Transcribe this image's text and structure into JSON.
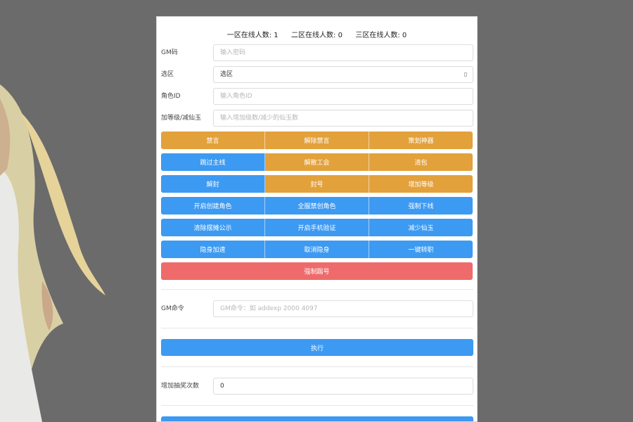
{
  "online": {
    "zone1_label": "一区在线人数:",
    "zone1_count": "1",
    "zone2_label": "二区在线人数:",
    "zone2_count": "0",
    "zone3_label": "三区在线人数:",
    "zone3_count": "0"
  },
  "form": {
    "gm_code": {
      "label": "GM码",
      "placeholder": "输入密码",
      "value": ""
    },
    "zone": {
      "label": "选区",
      "value": "选区"
    },
    "role_id": {
      "label": "角色ID",
      "placeholder": "输入角色ID",
      "value": ""
    },
    "level_jade": {
      "label": "加等级/减仙玉",
      "placeholder": "输入增加级数/减少的仙玉数",
      "value": ""
    }
  },
  "buttons": {
    "mute": "禁言",
    "unmute": "解除禁言",
    "planner_artifact": "策划神器",
    "skip_main_quest": "跳过主线",
    "disband_guild": "解散工会",
    "clear_bag": "清包",
    "unseal": "解封",
    "ban_account": "封号",
    "add_level": "增加等级",
    "enable_create_role": "开启创建角色",
    "ban_all_create_role": "全服禁创角色",
    "force_offline": "强制下线",
    "clear_stall_notice": "清除摆摊公示",
    "enable_phone_verify": "开启手机验证",
    "reduce_jade": "减少仙玉",
    "stealth_speedup": "隐身加速",
    "cancel_stealth": "取消隐身",
    "one_click_transfer": "一键转职",
    "force_kick": "强制踢号"
  },
  "gm_command": {
    "label": "GM命令",
    "placeholder": "GM命令：如 addexp 2000 4097",
    "value": "",
    "execute": "执行"
  },
  "lottery": {
    "label": "增加抽奖次数",
    "value": "0"
  },
  "colors": {
    "orange": "#e3a13b",
    "blue": "#3d9af2",
    "red": "#ef6b6b",
    "backdrop": "#6b6b6b"
  }
}
